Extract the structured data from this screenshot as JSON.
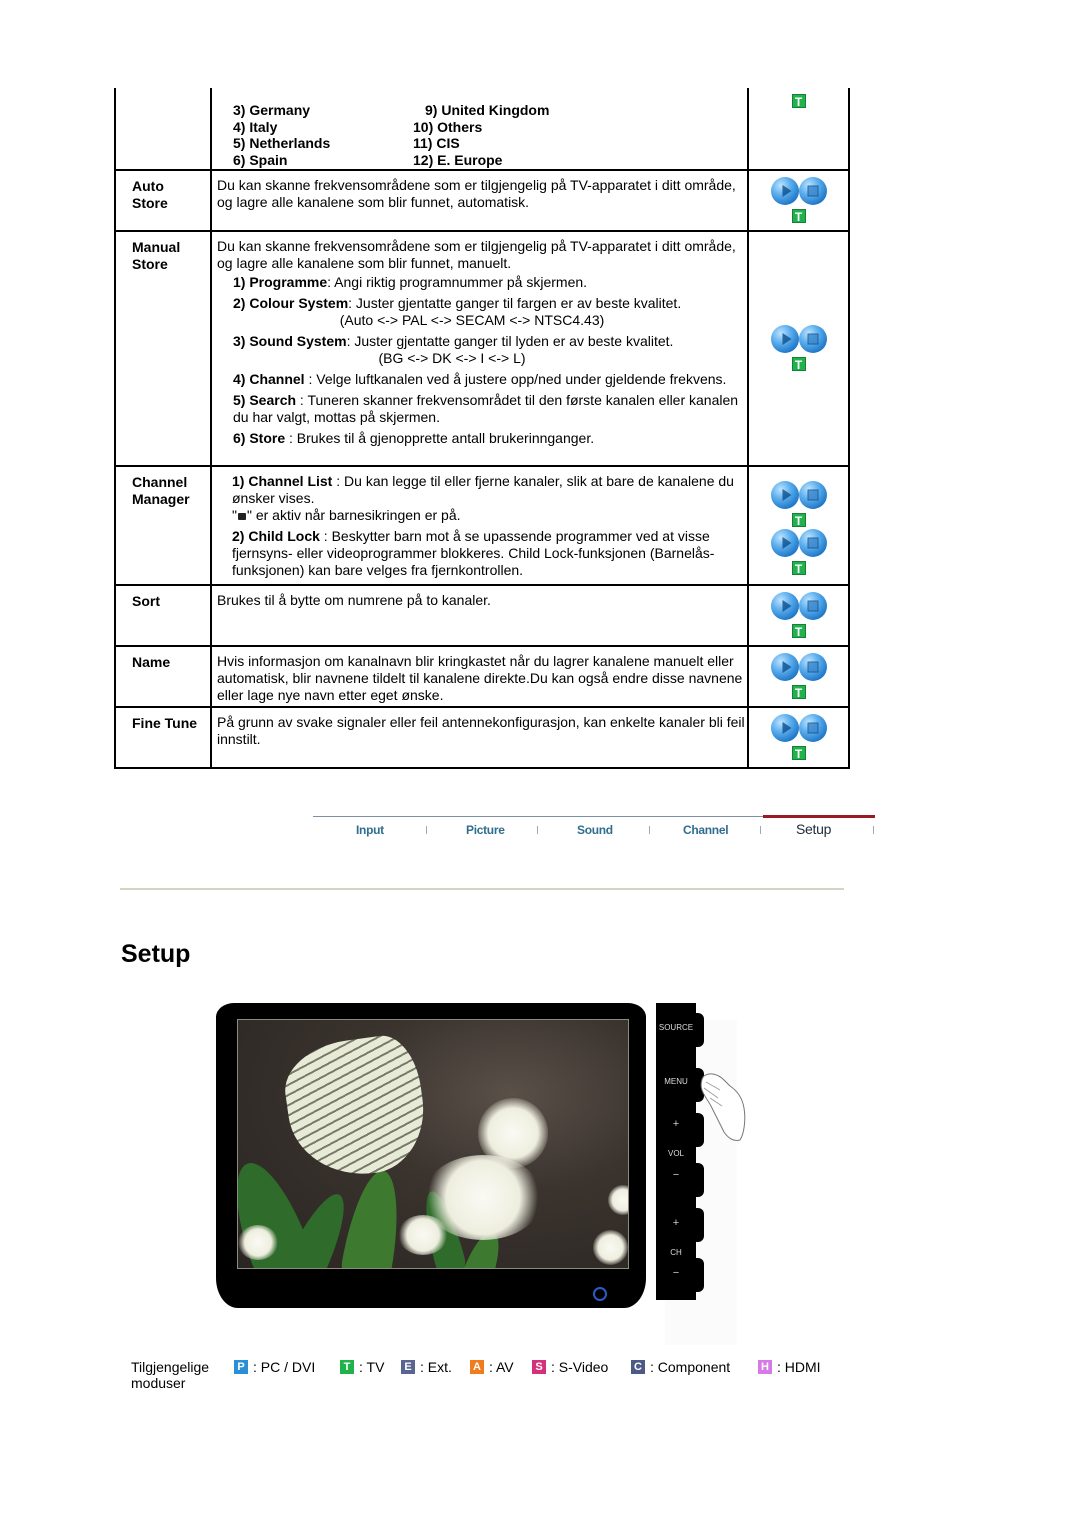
{
  "table": {
    "countries_left": [
      "3) Germany",
      "4) Italy",
      "5) Netherlands",
      "6) Spain"
    ],
    "countries_right": [
      "9) United Kingdom",
      "10) Others",
      "11) CIS",
      "12) E. Europe"
    ],
    "rows": [
      {
        "label_line1": "Auto",
        "label_line2": "Store",
        "description": "Du kan skanne frekvensområdene som er tilgjengelig på TV-apparatet i ditt område, og lagre alle kanalene som blir funnet, automatisk."
      },
      {
        "label_line1": "Manual",
        "label_line2": "Store",
        "description": "Du kan skanne frekvensområdene som er tilgjengelig på TV-apparatet i ditt område, og lagre alle kanalene som blir funnet, manuelt.",
        "items": [
          {
            "key": "1) Programme",
            "text": ": Angi riktig programnummer på skjermen."
          },
          {
            "key": "2) Colour System",
            "text": ": Juster gjentatte ganger til fargen er av beste kvalitet.",
            "extra": "(Auto <-> PAL <-> SECAM <-> NTSC4.43)"
          },
          {
            "key": "3) Sound System",
            "text": ": Juster gjentatte ganger til lyden er av beste kvalitet.",
            "extra": "(BG <-> DK <-> I <-> L)"
          },
          {
            "key": "4) Channel",
            "text": " : Velge luftkanalen ved å justere opp/ned under gjeldende frekvens."
          },
          {
            "key": "5) Search",
            "text": " : Tuneren skanner frekvensområdet til den første kanalen eller kanalen du har valgt, mottas på skjermen."
          },
          {
            "key": "6) Store",
            "text": " : Brukes til å gjenopprette antall brukerinnganger."
          }
        ]
      },
      {
        "label_line1": "Channel",
        "label_line2": "Manager",
        "items": [
          {
            "key": "1) Channel List",
            "text": " : Du kan legge til eller fjerne kanaler, slik at bare de kanalene du ønsker vises.",
            "extra_pre": "\"",
            "extra_post": "\" er aktiv når barnesikringen er på."
          },
          {
            "key": "2) Child Lock",
            "text": " : Beskytter barn mot å se upassende programmer ved at visse fjernsyns- eller videoprogrammer blokkeres. Child Lock-funksjonen (Barnelås-funksjonen) kan bare velges fra fjernkontrollen."
          }
        ]
      },
      {
        "label_line1": "Sort",
        "description": "Brukes til å bytte om numrene på to kanaler."
      },
      {
        "label_line1": "Name",
        "description": "Hvis informasjon om kanalnavn blir kringkastet når du lagrer kanalene manuelt eller automatisk, blir navnene tildelt til kanalene direkte.Du kan også endre disse navnene eller lage nye navn etter eget ønske."
      },
      {
        "label_line1": "Fine Tune",
        "description": "På grunn av svake signaler eller feil antennekonfigurasjon, kan enkelte kanaler bli feil innstilt."
      }
    ],
    "mode_badge": "T"
  },
  "nav": {
    "items": [
      "Input",
      "Picture",
      "Sound",
      "Channel",
      "Setup"
    ],
    "active": "Setup"
  },
  "section_title": "Setup",
  "tv_panel": {
    "buttons": [
      "SOURCE",
      "MENU",
      "+",
      "VOL",
      "−",
      "+",
      "CH",
      "−"
    ]
  },
  "legend": {
    "label": "Tilgjengelige moduser",
    "items": [
      {
        "badge": "P",
        "text": ": PC / DVI",
        "color": "#2b8fd6"
      },
      {
        "badge": "T",
        "text": ": TV",
        "color": "#22b24c"
      },
      {
        "badge": "E",
        "text": ": Ext.",
        "color": "#5a6490"
      },
      {
        "badge": "A",
        "text": ": AV",
        "color": "#f07c1e"
      },
      {
        "badge": "S",
        "text": ": S-Video",
        "color": "#d4317a"
      },
      {
        "badge": "C",
        "text": ": Component",
        "color": "#4d5a86"
      },
      {
        "badge": "H",
        "text": ": HDMI",
        "color": "#d67ae6"
      }
    ]
  }
}
